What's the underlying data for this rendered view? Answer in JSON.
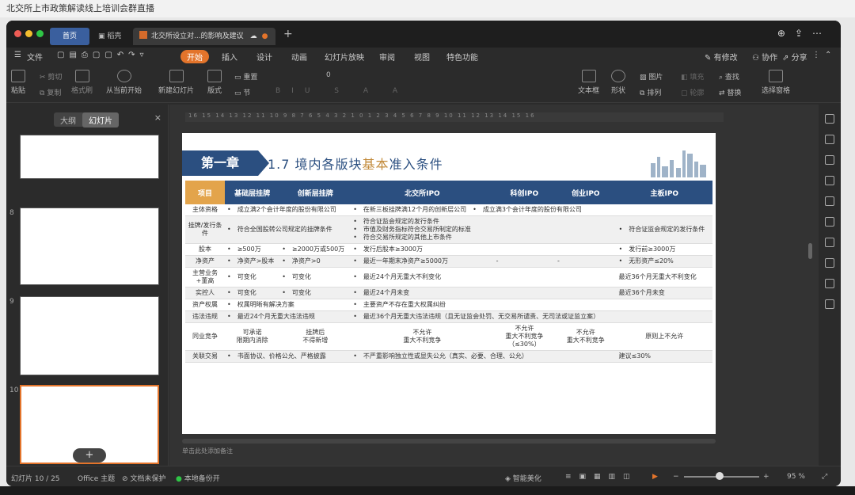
{
  "caption": "北交所上市政策解读线上培训会群直播",
  "tabs": {
    "home": "首页",
    "stash": "稻壳",
    "doc": "北交所设立对...的影响及建议"
  },
  "menu": {
    "file": "文件",
    "start": "开始",
    "insert": "插入",
    "design": "设计",
    "animation": "动画",
    "slideshow": "幻灯片放映",
    "review": "审阅",
    "view": "视图",
    "special": "特色功能",
    "has_changes": "有修改",
    "collab": "协作",
    "share": "分享"
  },
  "ribbon": {
    "paste": "粘贴",
    "cut": "剪切",
    "copy": "复制",
    "format_painter": "格式刷",
    "from_current": "从当前开始",
    "new_slide": "新建幻灯片",
    "layout": "版式",
    "reset": "重置",
    "section": "节",
    "font_size": "0",
    "textbox": "文本框",
    "shape": "形状",
    "picture": "图片",
    "arrange": "排列",
    "replace_img": "替换",
    "find": "查找",
    "replace": "替换",
    "select_pane": "选择窗格",
    "fill": "填充",
    "outline": "轮廓"
  },
  "left_panel": {
    "outline_tab": "大纲",
    "slides_tab": "幻灯片",
    "thumb_nums": [
      "8",
      "9",
      "10"
    ]
  },
  "ruler_text": "16  15  14  13  12  11  10  9  8  7  6  5  4  3  2  1  0  1  2  3  4  5  6  7  8  9  10  11  12  13  14  15  16",
  "slide": {
    "chapter": "第一章",
    "title_pre": "1.7 境内各版块",
    "title_hl": "基本",
    "title_post": "准入条件",
    "headers": [
      "项目",
      "基础层挂牌",
      "创新层挂牌",
      "北交所IPO",
      "科创IPO",
      "创业IPO",
      "主板IPO"
    ],
    "rows": [
      {
        "h": "主体资格",
        "c": [
          "•　成立满2个会计年度的股份有限公司",
          "",
          "•　在新三板挂牌满12个月的创新层公司　•　成立满3个会计年度的股份有限公司",
          "",
          "",
          ""
        ]
      },
      {
        "h": "挂牌/发行条件",
        "c": [
          "•　符合全国股转公司规定的挂牌条件",
          "",
          "•　符合证监会规定的发行条件\n•　市值及财务指标符合交易所制定的标准\n•　符合交易所规定的其他上市条件",
          "",
          "",
          "•　符合证监会规定的发行条件"
        ]
      },
      {
        "h": "股本",
        "c": [
          "•　≥500万",
          "•　≥2000万或500万",
          "•　发行后股本≥3000万",
          "",
          "",
          "•　发行前≥3000万"
        ]
      },
      {
        "h": "净资产",
        "c": [
          "•　净资产>股本",
          "•　净资产>0",
          "•　最近一年期末净资产≥5000万",
          "-",
          "-",
          "•　无形资产≤20%"
        ]
      },
      {
        "h": "主营业务+董高",
        "c": [
          "•　可变化",
          "•　可变化",
          "•　最近24个月无重大不利变化",
          "",
          "",
          "最近36个月无重大不利变化"
        ]
      },
      {
        "h": "实控人",
        "c": [
          "•　可变化",
          "•　可变化",
          "•　最近24个月未变",
          "",
          "",
          "最近36个月未变"
        ]
      },
      {
        "h": "资产权属",
        "c": [
          "•　权属明晰有解决方案",
          "",
          "•　主要资产不存在重大权属纠纷",
          "",
          "",
          ""
        ]
      },
      {
        "h": "违法违规",
        "c": [
          "•　最近24个月无重大违法违规",
          "",
          "•　最近36个月无重大违法违规（且无证监会处罚、无交易所谴责、无司法或证监立案）",
          "",
          "",
          ""
        ]
      },
      {
        "h": "同业竞争",
        "c": [
          "可承诺\n限期内消除",
          "挂牌后\n不得新增",
          "不允许\n重大不利竞争",
          "不允许\n重大不利竞争\n（≤30%）",
          "不允许\n重大不利竞争",
          "原则上不允许"
        ]
      },
      {
        "h": "关联交易",
        "c": [
          "•　书面协议、价格公允、严格披露",
          "",
          "•　不严重影响独立性或显失公允（真实、必要、合理、公允）",
          "",
          "",
          "建议≤30%"
        ]
      }
    ]
  },
  "notes_placeholder": "单击此处添加备注",
  "status": {
    "slide_count": "幻灯片 10 / 25",
    "theme": "Office 主题",
    "unprotected": "文档未保护",
    "backup": "本地备份开",
    "beautify": "智能美化",
    "zoom": "95 %"
  }
}
